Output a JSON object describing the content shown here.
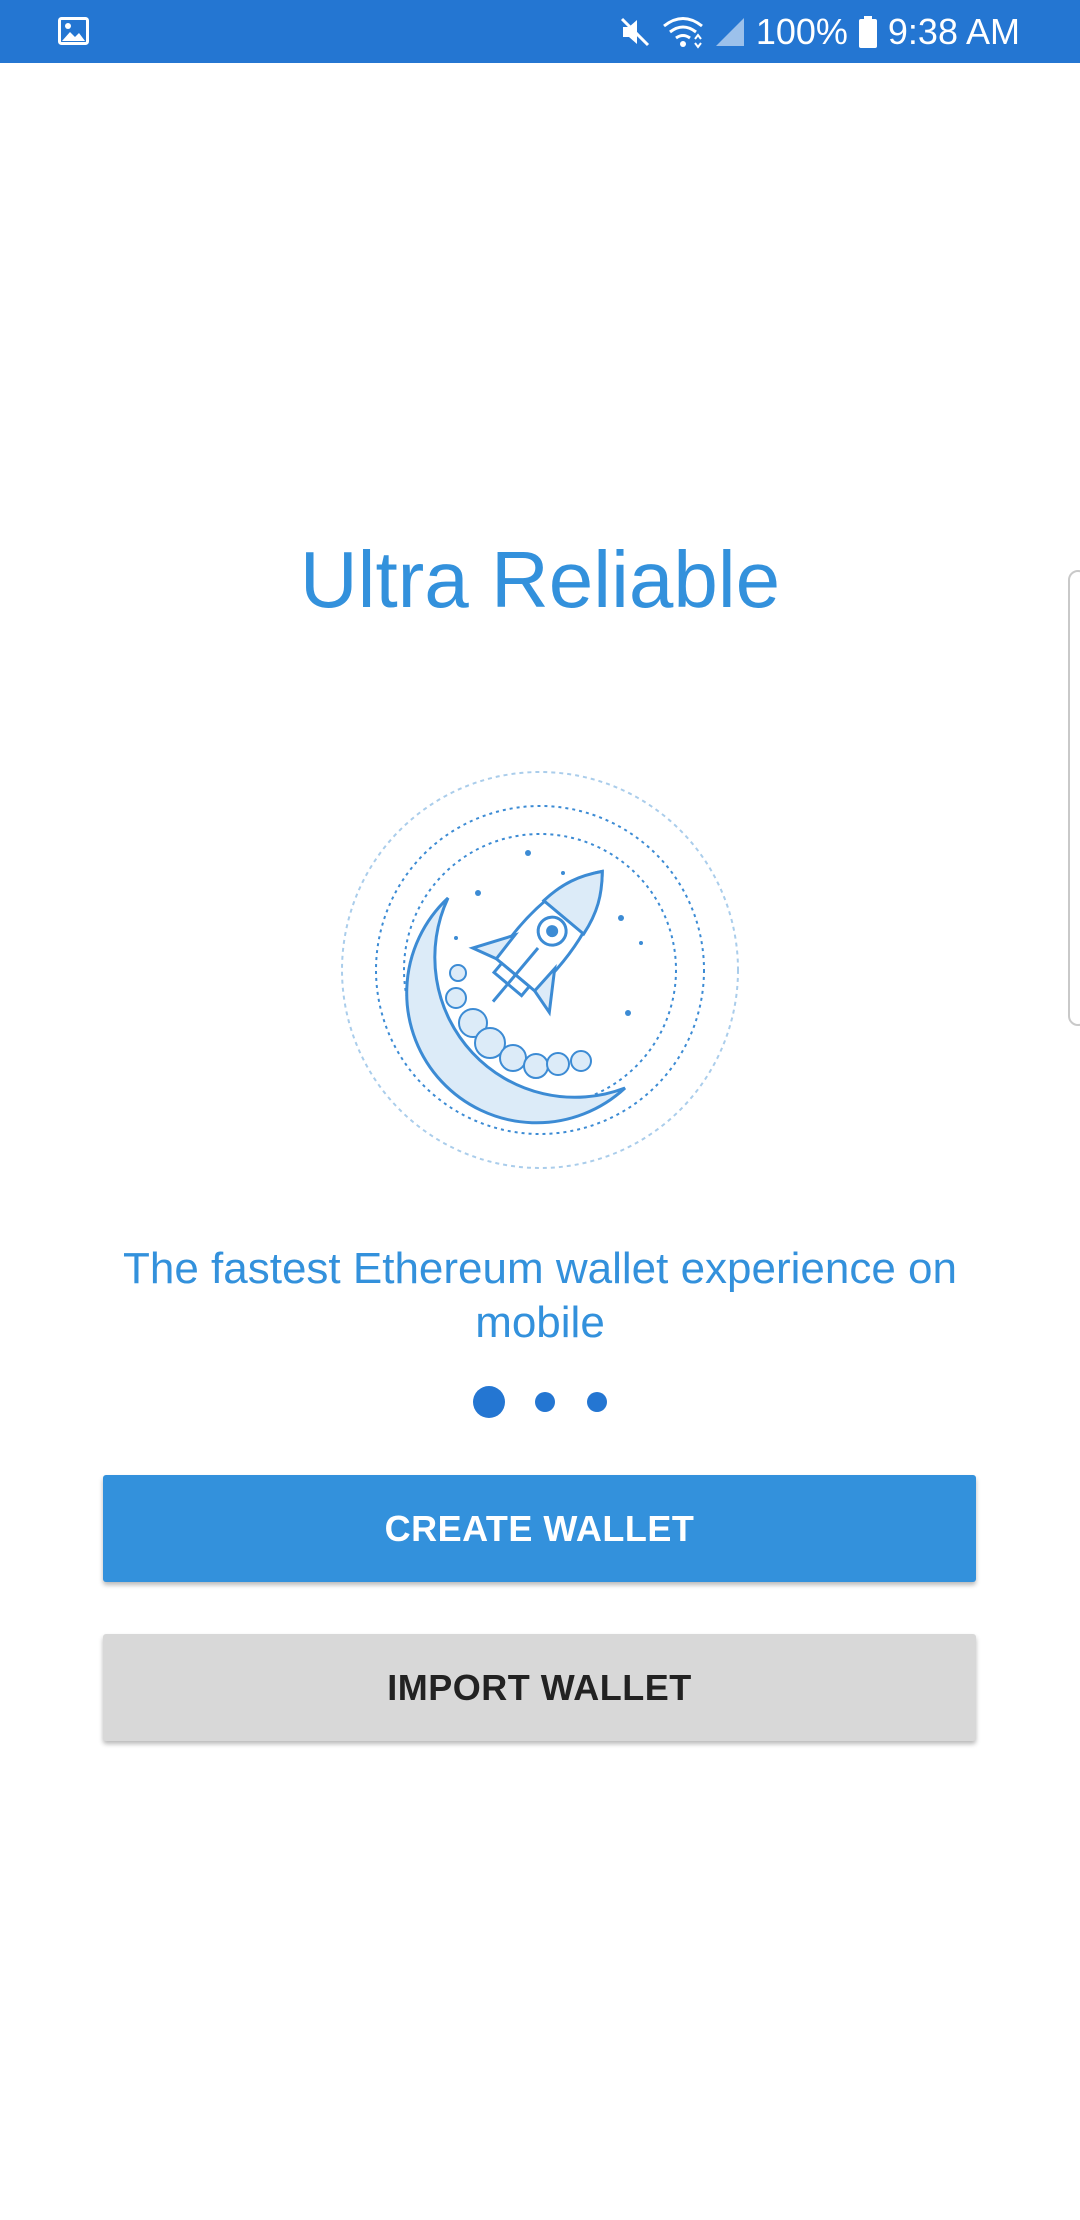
{
  "status_bar": {
    "battery_text": "100%",
    "time": "9:38 AM",
    "icons": [
      "gallery-icon",
      "mute-icon",
      "wifi-icon",
      "signal-icon",
      "battery-icon"
    ],
    "background_color": "#2476d2"
  },
  "onboarding": {
    "title": "Ultra Reliable",
    "illustration": "rocket-launch-icon",
    "subtitle": "The fastest Ethereum wallet experience on mobile",
    "pager": {
      "total_pages": 3,
      "active_page": 1
    },
    "accent_color": "#3391dc"
  },
  "actions": {
    "create_label": "CREATE WALLET",
    "import_label": "IMPORT WALLET"
  }
}
